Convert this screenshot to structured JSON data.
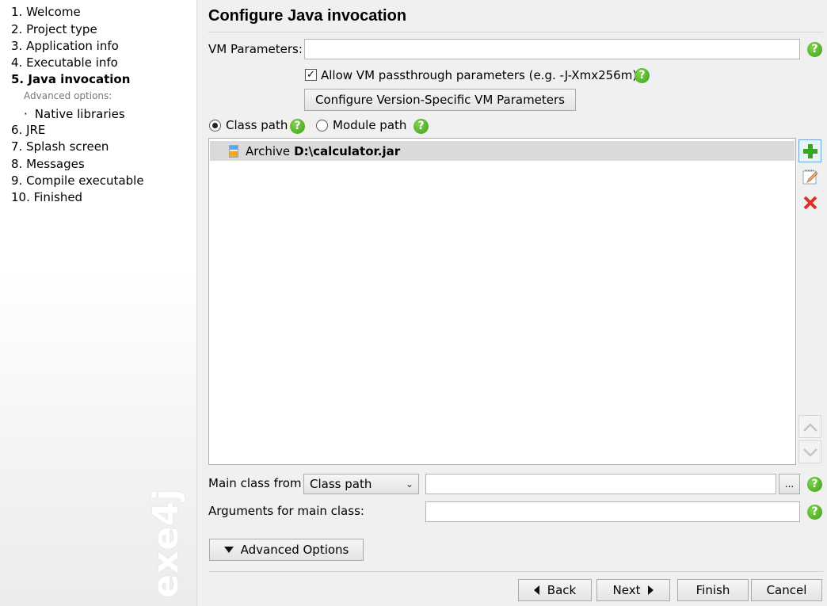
{
  "sidebar": {
    "steps": [
      {
        "label": "1. Welcome"
      },
      {
        "label": "2. Project type"
      },
      {
        "label": "3. Application info"
      },
      {
        "label": "4. Executable info"
      },
      {
        "label": "5. Java invocation"
      },
      {
        "label": "6. JRE"
      },
      {
        "label": "7. Splash screen"
      },
      {
        "label": "8. Messages"
      },
      {
        "label": "9. Compile executable"
      },
      {
        "label": "10. Finished"
      }
    ],
    "active_step": "5. Java invocation",
    "advanced_label": "Advanced options:",
    "sub_item": "Native libraries",
    "watermark": "exe4j"
  },
  "page": {
    "title": "Configure Java invocation"
  },
  "vm": {
    "label": "VM Parameters:",
    "value": "",
    "passthrough_label": "Allow VM passthrough parameters (e.g. -J-Xmx256m)",
    "passthrough_checked": true,
    "version_button": "Configure Version-Specific VM Parameters"
  },
  "path_mode": {
    "class_path_label": "Class path",
    "module_path_label": "Module path",
    "selected": "Class path"
  },
  "classpath": {
    "entries": [
      {
        "type": "Archive",
        "path": "D:\\calculator.jar"
      }
    ]
  },
  "main_class": {
    "label": "Main class from",
    "source": "Class path",
    "value": "",
    "browse_label": "..."
  },
  "arguments": {
    "label": "Arguments for main class:",
    "value": ""
  },
  "advanced_button": "Advanced Options",
  "footer": {
    "back": "Back",
    "next": "Next",
    "finish": "Finish",
    "cancel": "Cancel"
  },
  "help_glyph": "?",
  "colors": {
    "help_green": "#4caf23",
    "selection_gray": "#dadada",
    "delete_red": "#e0302a",
    "add_green": "#3aa521"
  }
}
